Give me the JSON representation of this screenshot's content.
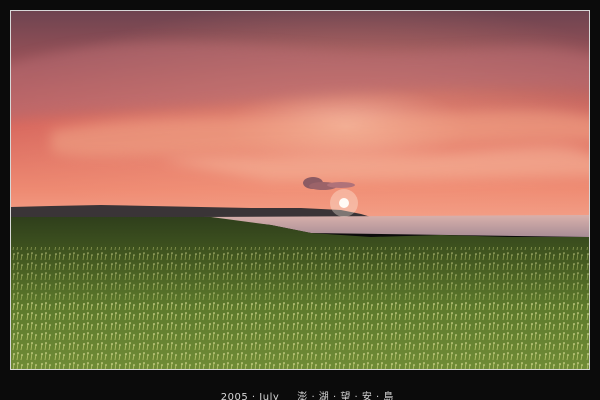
{
  "caption": {
    "date": "2005 · July",
    "location": "澎 · 湖 · 望 · 安 · 島"
  },
  "colors": {
    "frame": "#0b0b0b",
    "border": "#d8d8d8",
    "sky_top": "#7a4a52",
    "sky_mid": "#d96a63",
    "horizon_glow": "#f2a58b",
    "sea": "#c9a4a4",
    "grass": "#4f6a2a",
    "sun": "#ffffff"
  }
}
